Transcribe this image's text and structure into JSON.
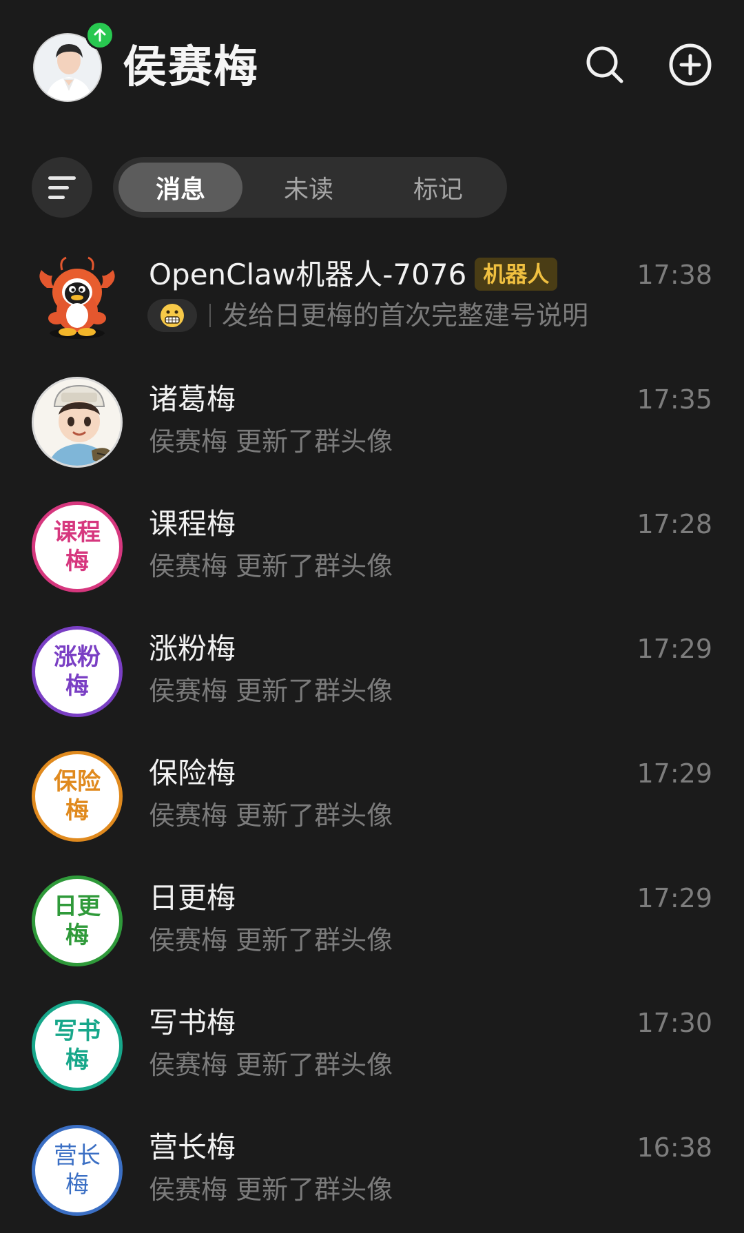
{
  "header": {
    "user_name": "侯赛梅",
    "avatar_icon": "user-photo",
    "badge_icon": "upload-arrow-icon",
    "actions": [
      {
        "name": "search",
        "icon": "search-icon"
      },
      {
        "name": "add",
        "icon": "plus-circle-icon"
      }
    ]
  },
  "filter": {
    "menu_icon": "menu-lines-icon",
    "tabs": [
      {
        "label": "消息",
        "active": true
      },
      {
        "label": "未读",
        "active": false
      },
      {
        "label": "标记",
        "active": false
      }
    ]
  },
  "chats": [
    {
      "name": "OpenClaw机器人-7076",
      "badge": "机器人",
      "time": "17:38",
      "preview": "发给日更梅的首次完整建号说明",
      "avatar": "lobster-mascot",
      "preview_icon": "grimace-emoji-icon"
    },
    {
      "name": "诸葛梅",
      "time": "17:35",
      "preview": "侯赛梅 更新了群头像",
      "avatar": "cartoon-zhuge-avatar"
    },
    {
      "name": "课程梅",
      "time": "17:28",
      "preview": "侯赛梅 更新了群头像",
      "avatar_text_top": "课程",
      "avatar_text_bottom": "梅",
      "color": "#d6377e"
    },
    {
      "name": "涨粉梅",
      "time": "17:29",
      "preview": "侯赛梅 更新了群头像",
      "avatar_text_top": "涨粉",
      "avatar_text_bottom": "梅",
      "color": "#7a3fc4"
    },
    {
      "name": "保险梅",
      "time": "17:29",
      "preview": "侯赛梅 更新了群头像",
      "avatar_text_top": "保险",
      "avatar_text_bottom": "梅",
      "color": "#e08a1e"
    },
    {
      "name": "日更梅",
      "time": "17:29",
      "preview": "侯赛梅 更新了群头像",
      "avatar_text_top": "日更",
      "avatar_text_bottom": "梅",
      "color": "#2f9a3a"
    },
    {
      "name": "写书梅",
      "time": "17:30",
      "preview": "侯赛梅 更新了群头像",
      "avatar_text_top": "写书",
      "avatar_text_bottom": "梅",
      "color": "#17a78a"
    },
    {
      "name": "营长梅",
      "time": "16:38",
      "preview": "侯赛梅 更新了群头像",
      "avatar_text_top": "营长",
      "avatar_text_bottom": "梅",
      "color": "#3b6fc4"
    }
  ]
}
